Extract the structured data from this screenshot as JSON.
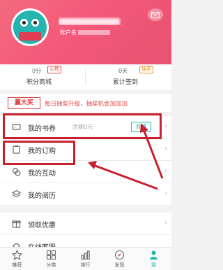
{
  "header": {
    "username": "Hai ... 10 ...",
    "account_label": "账户名",
    "message_icon": "message-icon"
  },
  "stats": [
    {
      "value": "0分",
      "tag": "火热",
      "label": "积分商城",
      "tag_color": "#e24a4a"
    },
    {
      "value": "0天",
      "tag": "抽奖",
      "label": "累计签到",
      "tag_color": "#e8902c"
    }
  ],
  "banner": {
    "badge": "赢大奖",
    "text": "每日抽奖升级，抽奖机会加加加"
  },
  "menu": [
    {
      "label": "我的书券",
      "extra": "余额0元",
      "action": "充值",
      "icon": "ticket-icon"
    },
    {
      "label": "我的订购",
      "icon": "clipboard-icon"
    },
    {
      "label": "我的互动",
      "icon": "chat-icon"
    },
    {
      "label": "我的阅历",
      "icon": "layers-icon"
    },
    {
      "label": "领取优惠",
      "icon": "gift-icon"
    },
    {
      "label": "在线客服",
      "icon": "headset-icon"
    }
  ],
  "tabs": [
    {
      "label": "推荐",
      "icon": "star-icon"
    },
    {
      "label": "分类",
      "icon": "grid-icon"
    },
    {
      "label": "排行",
      "icon": "bar-chart-icon"
    },
    {
      "label": "发现",
      "icon": "compass-icon"
    },
    {
      "label": "我",
      "icon": "person-icon",
      "active": true
    }
  ],
  "colors": {
    "accent": "#1fb3a8",
    "header": "#f4587a",
    "highlight": "#c8202f"
  }
}
